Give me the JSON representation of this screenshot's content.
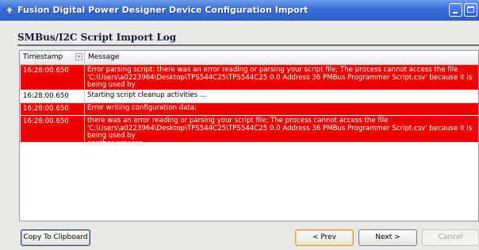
{
  "window": {
    "title": "Fusion Digital Power Designer Device Configuration Import"
  },
  "page": {
    "heading": "SMBus/I2C Script Import Log"
  },
  "grid": {
    "columns": [
      "Timestamp",
      "Message"
    ],
    "rows": [
      {
        "timestamp": "16:28:00.650",
        "message": "Error parsing script: there was an error reading or parsing your script file; The process cannot access the file\n'C:\\Users\\a0223964\\Desktop\\TPS544C25\\TPS544C25 0.0 Address 36 PMBus Programmer Script.csv' because it is being used by\nanother process.",
        "status": "error"
      },
      {
        "timestamp": "16:28:00.650",
        "message": "Starting script cleanup activities ...",
        "status": "ok"
      },
      {
        "timestamp": "16:28:00.650",
        "message": "Error writing configuration data:",
        "status": "error"
      },
      {
        "timestamp": "16:28:00.650",
        "message": "there was an error reading or parsing your script file; The process cannot access the file\n'C:\\Users\\a0223964\\Desktop\\TPS544C25\\TPS544C25 0.0 Address 36 PMBus Programmer Script.csv' because it is being used by\nanother process.",
        "status": "error"
      }
    ]
  },
  "buttons": {
    "copy": "Copy To Clipboard",
    "prev": "< Prev",
    "next": "Next >",
    "cancel": "Cancel"
  },
  "colors": {
    "error_row": "#ef0000",
    "titlebar": "#3b6fd6"
  },
  "icons": {
    "app": "fusion-app-icon",
    "filter": "filter-icon",
    "minimize": "minimize-icon",
    "maximize": "maximize-icon"
  }
}
